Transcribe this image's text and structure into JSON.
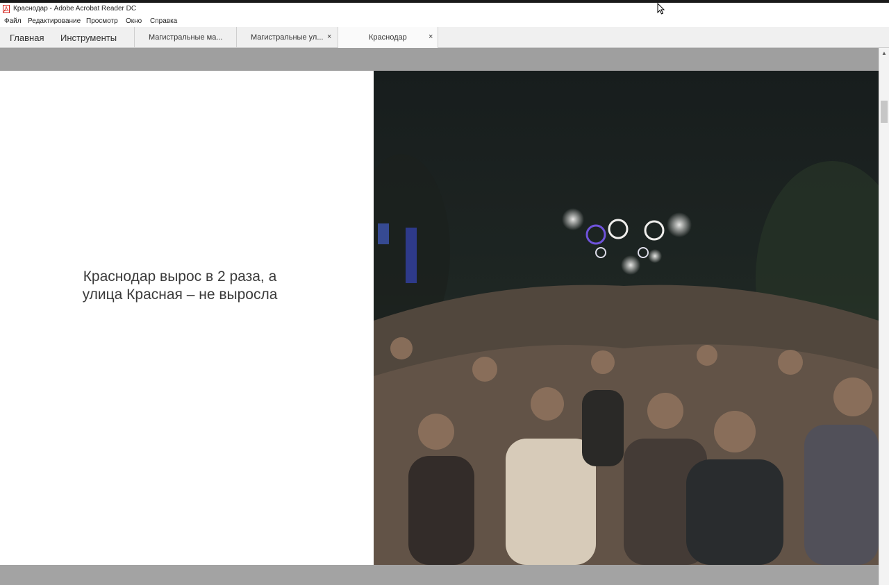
{
  "window": {
    "title": "Краснодар - Adobe Acrobat Reader DC",
    "icon": "pdf-icon"
  },
  "menu": [
    "Файл",
    "Редактирование",
    "Просмотр",
    "Окно",
    "Справка"
  ],
  "nav_tabs": {
    "home": "Главная",
    "tools": "Инструменты"
  },
  "document_tabs": [
    {
      "label": "Магистральные ма..."
    },
    {
      "label": "Магистральные ул...",
      "close": "×"
    },
    {
      "label": "Краснодар",
      "close": "×",
      "active": true
    }
  ],
  "page": {
    "headline_line1": "Краснодар вырос в 2 раза, а",
    "headline_line2": "улица Красная – не выросла",
    "photo": "night street crowd with lights"
  },
  "colors": {
    "acrobat_red": "#d4231c",
    "page_background": "#ffffff",
    "viewer_background": "#a6a6a6"
  }
}
